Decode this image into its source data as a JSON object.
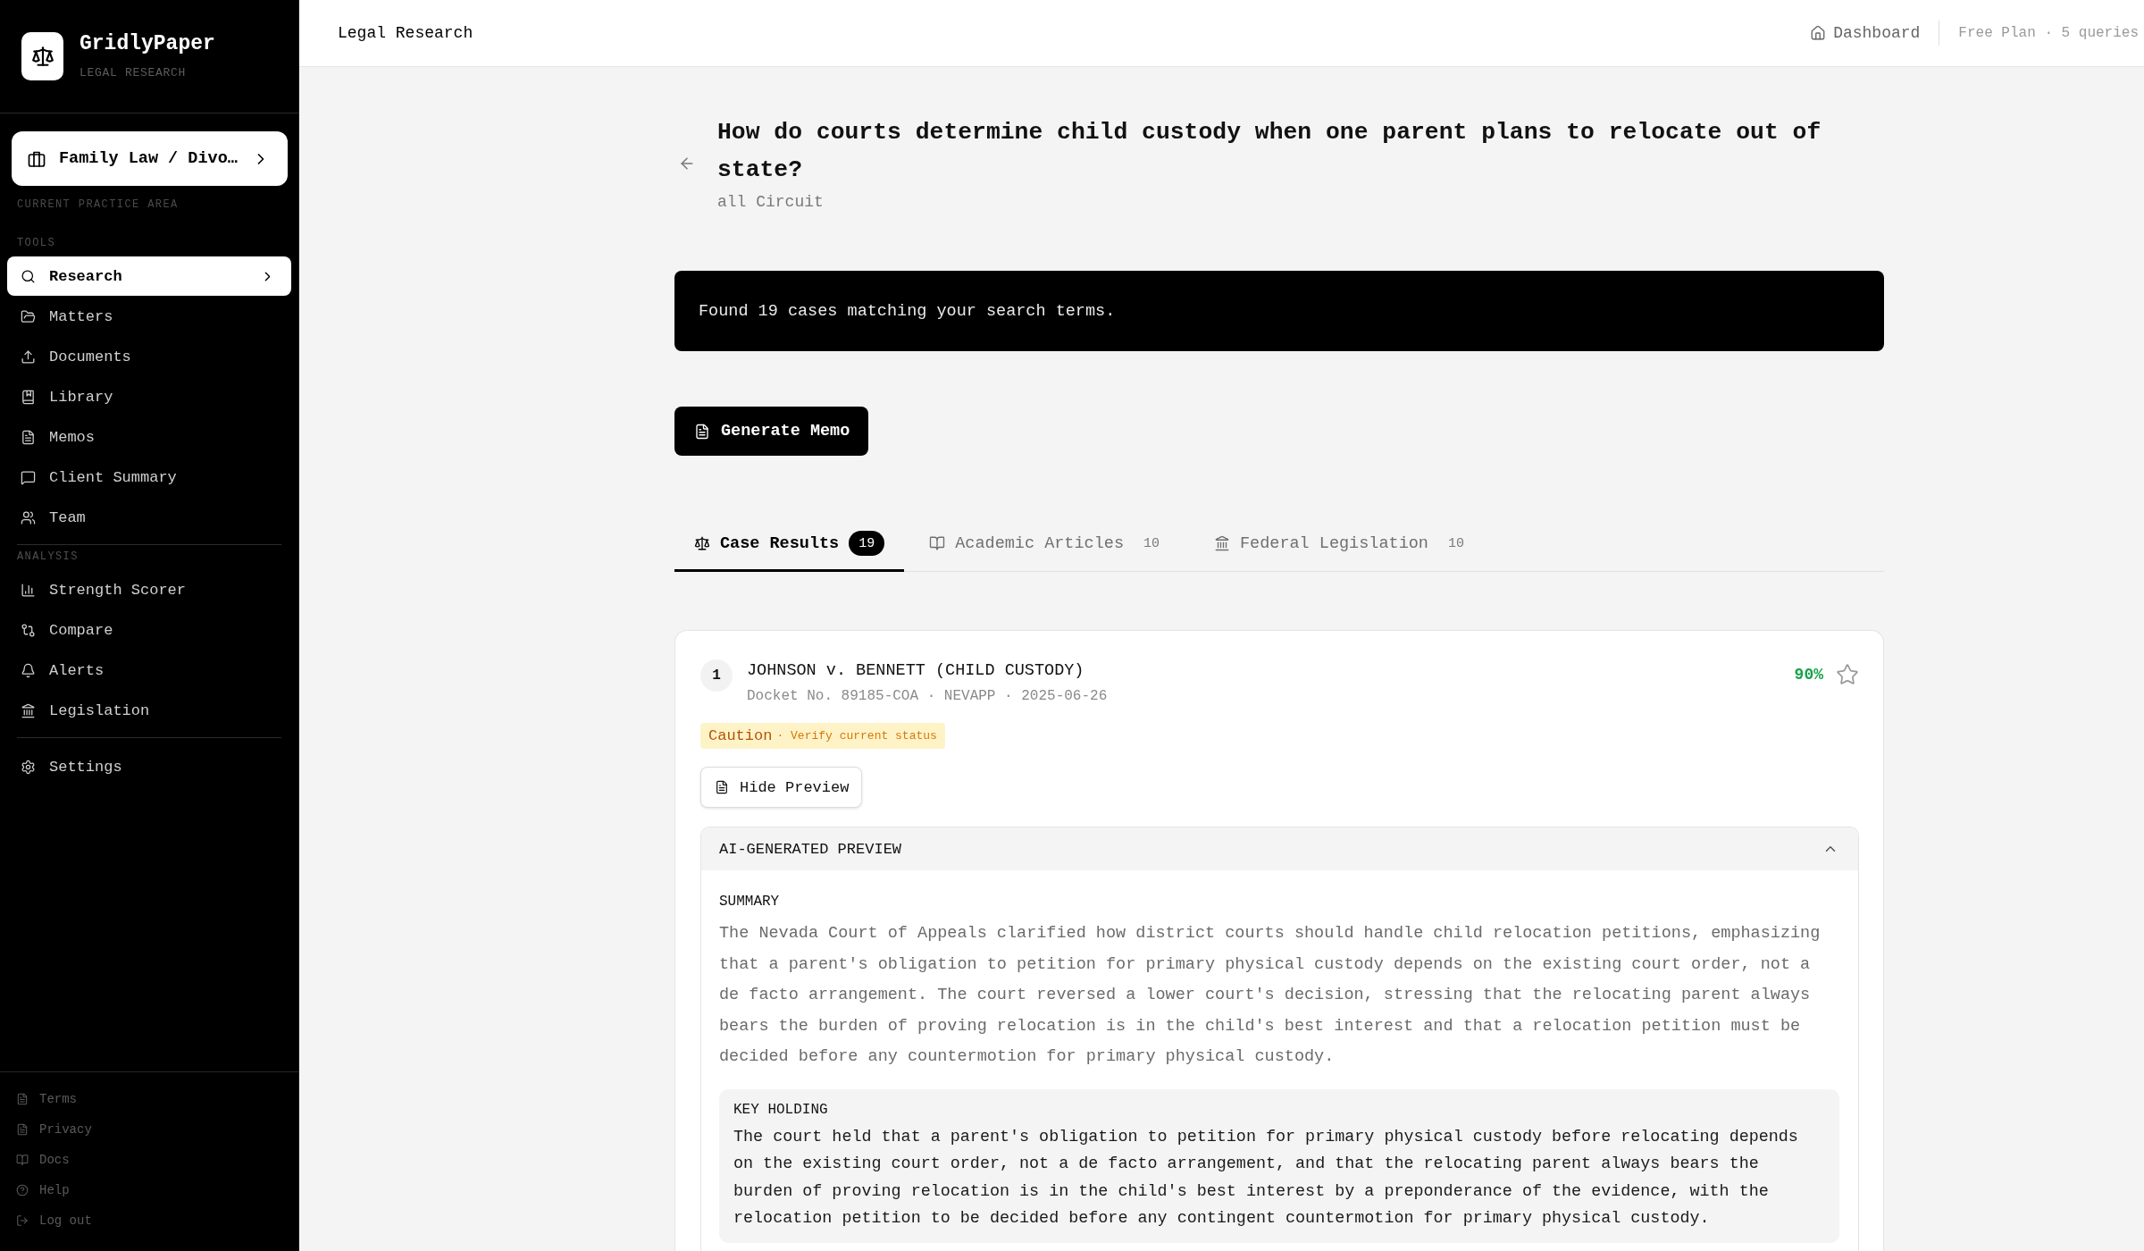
{
  "sidebar": {
    "brand": {
      "name": "GridlyPaper",
      "tagline": "LEGAL RESEARCH"
    },
    "practice_area": {
      "label": "Family Law / Divo…",
      "caption": "CURRENT PRACTICE AREA"
    },
    "sections": [
      {
        "heading": "TOOLS",
        "items": [
          {
            "label": "Research",
            "selected": true
          },
          {
            "label": "Matters",
            "selected": false
          },
          {
            "label": "Documents",
            "selected": false
          },
          {
            "label": "Library",
            "selected": false
          },
          {
            "label": "Memos",
            "selected": false
          },
          {
            "label": "Client Summary",
            "selected": false
          },
          {
            "label": "Team",
            "selected": false
          }
        ]
      },
      {
        "heading": "ANALYSIS",
        "items": [
          {
            "label": "Strength Scorer",
            "selected": false
          },
          {
            "label": "Compare",
            "selected": false
          },
          {
            "label": "Alerts",
            "selected": false
          },
          {
            "label": "Legislation",
            "selected": false
          }
        ]
      },
      {
        "items": [
          {
            "label": "Settings",
            "selected": false
          }
        ]
      }
    ],
    "footer_links": [
      "Terms",
      "Privacy",
      "Docs",
      "Help",
      "Log out"
    ]
  },
  "header": {
    "title": "Legal Research",
    "dashboard_link": "Dashboard",
    "plan": "Free Plan · 5 queries"
  },
  "query": {
    "question": "How do courts determine child custody when one parent plans to relocate out of state?",
    "jurisdiction": "all Circuit"
  },
  "result_banner": "Found 19 cases matching your search terms.",
  "generate_button": "Generate Memo",
  "tabs": [
    {
      "label": "Case Results",
      "count": "19",
      "selected": true
    },
    {
      "label": "Academic Articles",
      "count": "10",
      "selected": false
    },
    {
      "label": "Federal Legislation",
      "count": "10",
      "selected": false
    }
  ],
  "results": [
    {
      "rank": "1",
      "title": "JOHNSON v. BENNETT (CHILD CUSTODY)",
      "meta": "Docket No. 89185-COA · NEVAPP · 2025-06-26",
      "score": "90%",
      "starred": false,
      "status": {
        "kind": "caution",
        "label": "Caution",
        "note": "· Verify current status"
      },
      "preview_button": "Hide Preview",
      "preview": {
        "expanded": true,
        "heading": "AI-GENERATED PREVIEW",
        "summary_heading": "SUMMARY",
        "summary": "The Nevada Court of Appeals clarified how district courts should handle child relocation petitions, emphasizing that a parent's obligation to petition for primary physical custody depends on the existing court order, not a de facto arrangement. The court reversed a lower court's decision, stressing that the relocating parent always bears the burden of proving relocation is in the child's best interest and that a relocation petition must be decided before any countermotion for primary physical custody.",
        "key_holding_heading": "KEY HOLDING",
        "key_holding": "The court held that a parent's obligation to petition for primary physical custody before relocating depends on the existing court order, not a de facto arrangement, and that the relocating parent always bears the burden of proving relocation is in the child's best interest by a preponderance of the evidence, with the relocation petition to be decided before any contingent countermotion for primary physical custody."
      }
    }
  ]
}
